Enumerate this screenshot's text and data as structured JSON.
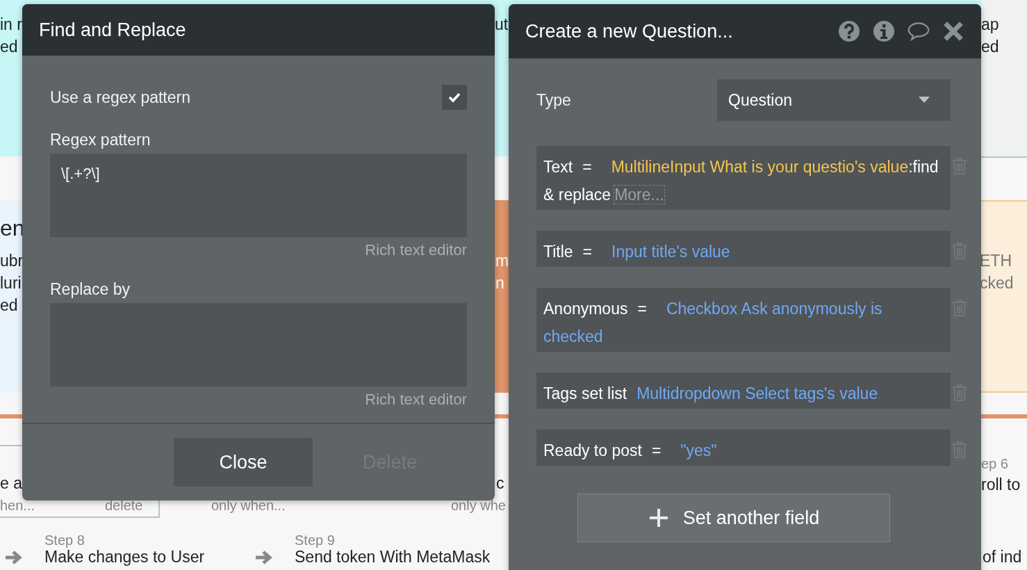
{
  "background": {
    "fragments": [
      "in r",
      "ed",
      "ut",
      "ap",
      "ed",
      "en",
      "ubr",
      "luri",
      "ed",
      "m",
      "n",
      "ETH",
      "cked",
      "e a",
      "hen...",
      "delete",
      "only when...",
      "c",
      "only whe",
      "ep 6",
      "roll to",
      "of ind",
      "Step 8",
      "Make changes to User",
      "Step 9",
      "Send token With MetaMask"
    ]
  },
  "find_replace": {
    "title": "Find and Replace",
    "use_regex": {
      "label": "Use a regex pattern",
      "checked": true
    },
    "pattern": {
      "label": "Regex pattern",
      "value": "\\[.+?\\]",
      "hint": "Rich text editor"
    },
    "replace": {
      "label": "Replace by",
      "hint": "Rich text editor"
    },
    "buttons": [
      {
        "label": "Close",
        "disabled": false
      },
      {
        "label": "Delete",
        "disabled": true
      }
    ]
  },
  "action": {
    "title": "Create a new Question...",
    "type": {
      "label": "Type",
      "value": "Question"
    },
    "fields": [
      {
        "label": "Text",
        "operator": "=",
        "parts": [
          {
            "kind": "element",
            "text": "MultilineInput What is your questio's value"
          },
          {
            "kind": "operator",
            "text": ":find & replace"
          },
          {
            "kind": "more",
            "text": "More..."
          }
        ]
      },
      {
        "label": "Title",
        "operator": "=",
        "parts": [
          {
            "kind": "data",
            "text": "Input title's value"
          }
        ]
      },
      {
        "label": "Anonymous",
        "operator": "=",
        "parts": [
          {
            "kind": "data",
            "text": "Checkbox Ask anonymously is checked"
          }
        ]
      },
      {
        "label": "Tags set list",
        "parts": [
          {
            "kind": "data",
            "text": "Multidropdown Select tags's value"
          }
        ]
      },
      {
        "label": "Ready to post",
        "operator": "=",
        "parts": [
          {
            "kind": "data",
            "text": "\"yes\""
          }
        ]
      }
    ],
    "add_button": "Set another field"
  }
}
